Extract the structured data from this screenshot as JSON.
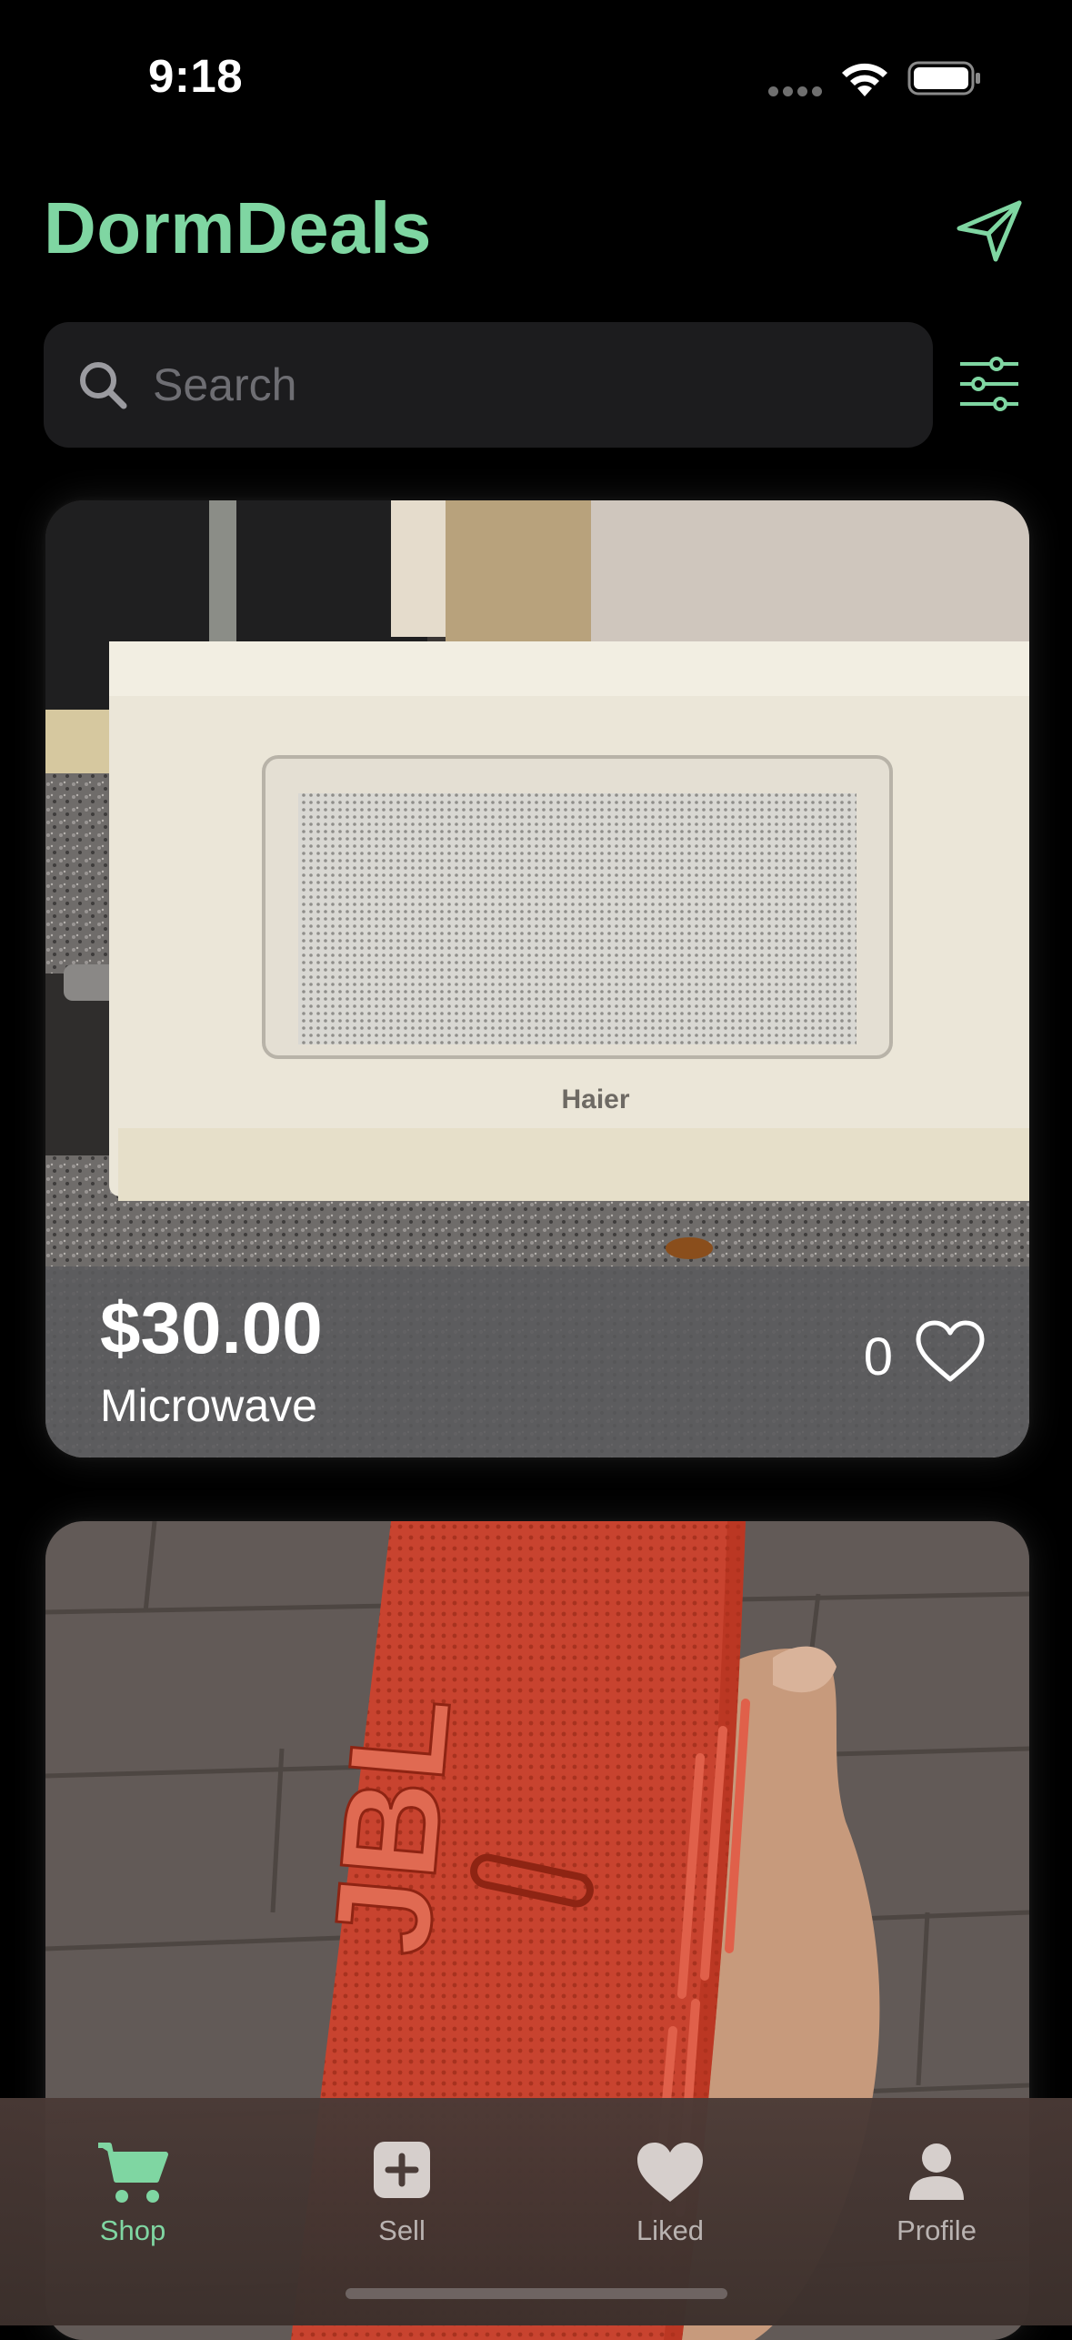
{
  "status_bar": {
    "time": "9:18"
  },
  "header": {
    "title": "DormDeals",
    "send_icon": "paper-plane-icon"
  },
  "search": {
    "placeholder": "Search",
    "value": "",
    "filter_icon": "sliders-icon"
  },
  "listings": [
    {
      "price": "$30.00",
      "name": "Microwave",
      "likes": "0",
      "photo": "white Haier microwave on counter"
    },
    {
      "price": "",
      "name": "",
      "likes": "",
      "photo": "red JBL speaker held in hand"
    }
  ],
  "tab_bar": {
    "tabs": [
      {
        "label": "Shop",
        "icon": "cart-icon",
        "active": true
      },
      {
        "label": "Sell",
        "icon": "plus-square-icon",
        "active": false
      },
      {
        "label": "Liked",
        "icon": "heart-icon",
        "active": false
      },
      {
        "label": "Profile",
        "icon": "person-icon",
        "active": false
      }
    ]
  },
  "colors": {
    "accent": "#7fd6a2",
    "background": "#000000",
    "search_bg": "#1c1c1e",
    "tab_inactive": "#b9b3b1"
  }
}
